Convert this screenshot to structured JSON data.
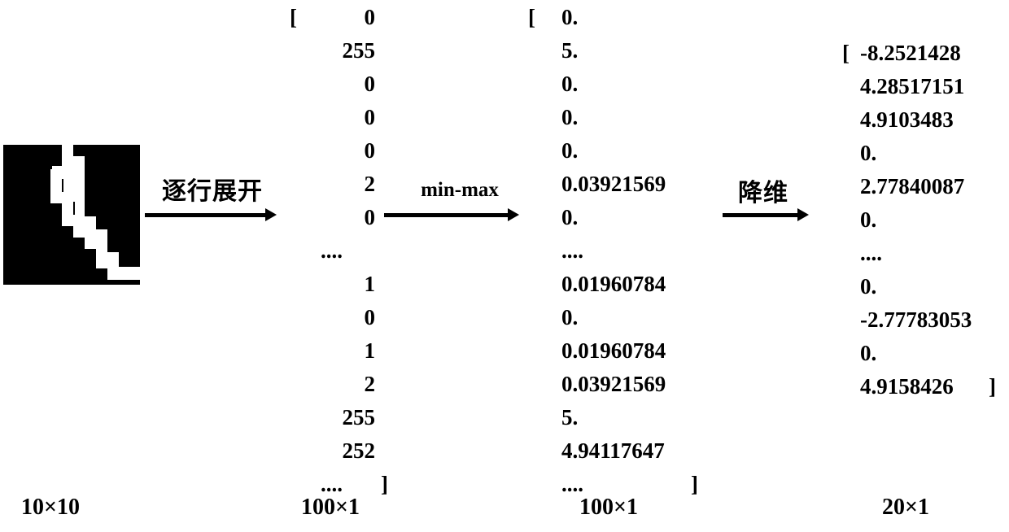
{
  "figure": {
    "title": "image to vector pipeline",
    "background_color": "#ffffff",
    "ink_color": "#000000"
  },
  "source_image": {
    "name": "binary-digit-image",
    "description": "10x10 black and white handwritten digit patch",
    "size_label": "10×10"
  },
  "arrows": [
    {
      "label": "逐行展开",
      "lang": "zh",
      "meaning": "flatten row by row"
    },
    {
      "label": "min-max",
      "lang": "en",
      "meaning": "min-max normalization"
    },
    {
      "label": "降维",
      "lang": "zh",
      "meaning": "dimensionality reduction"
    }
  ],
  "stages": [
    {
      "id": "raw-pixels",
      "size_label": "100×1",
      "open_bracket": "[",
      "close_bracket": "]",
      "rows": [
        "0",
        "255",
        "0",
        "0",
        "0",
        "2",
        "0",
        "....",
        "1",
        "0",
        "1",
        "2",
        "255",
        "252",
        "...."
      ]
    },
    {
      "id": "normalized",
      "size_label": "100×1",
      "open_bracket": "[",
      "close_bracket": "]",
      "rows": [
        "0.",
        "5.",
        "0.",
        "0.",
        "0.",
        "0.03921569",
        "0.",
        "....",
        "0.01960784",
        "0.",
        "0.01960784",
        "0.03921569",
        "5.",
        "4.94117647",
        "...."
      ]
    },
    {
      "id": "reduced",
      "size_label": "20×1",
      "open_bracket": "[",
      "close_bracket": "]",
      "rows": [
        "-8.2521428",
        "4.28517151",
        "4.9103483",
        "0.",
        "2.77840087",
        "0.",
        "....",
        "0.",
        "-2.77783053",
        "0.",
        "4.9158426"
      ]
    }
  ]
}
